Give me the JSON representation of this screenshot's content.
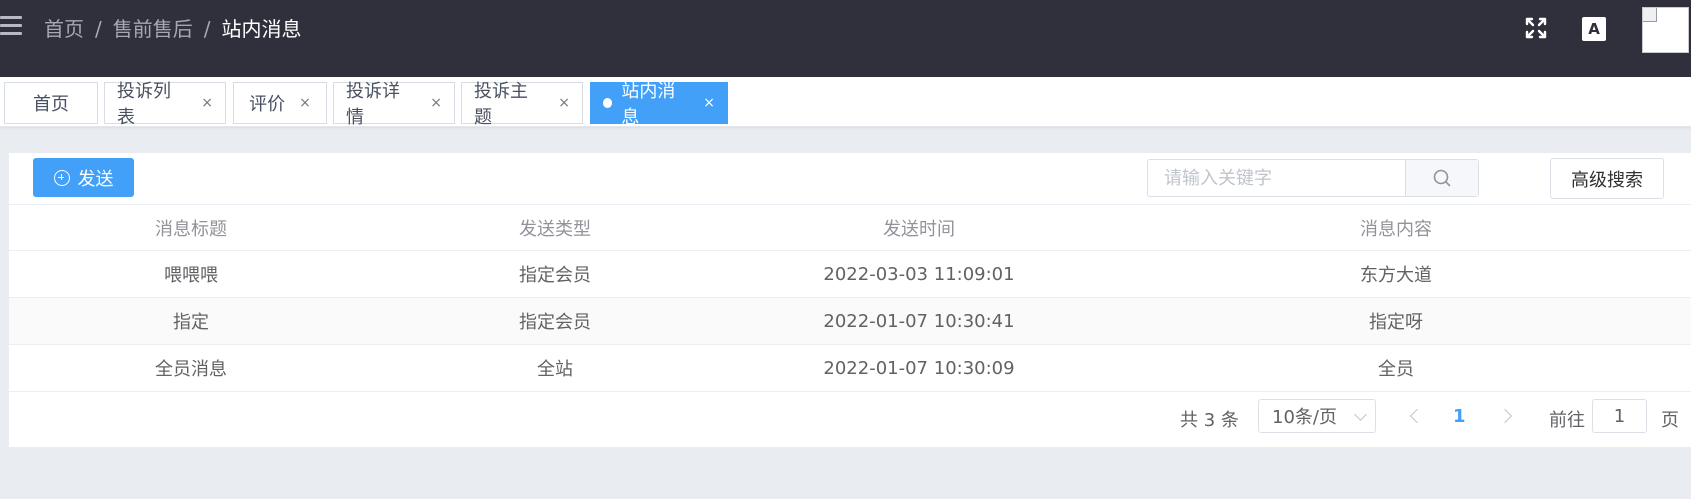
{
  "breadcrumb": [
    "首页",
    "售前售后",
    "站内消息"
  ],
  "breadcrumb_separator": "/",
  "tags": [
    {
      "label": "首页",
      "closable": false,
      "active": false
    },
    {
      "label": "投诉列表",
      "closable": true,
      "active": false
    },
    {
      "label": "评价",
      "closable": true,
      "active": false
    },
    {
      "label": "投诉详情",
      "closable": true,
      "active": false
    },
    {
      "label": "投诉主题",
      "closable": true,
      "active": false
    },
    {
      "label": "站内消息",
      "closable": true,
      "active": true
    }
  ],
  "tag_close_glyph": "×",
  "toolbar": {
    "send_label": "发送",
    "search_placeholder": "请输入关键字",
    "advanced_search_label": "高级搜索"
  },
  "table": {
    "columns": [
      "消息标题",
      "发送类型",
      "发送时间",
      "消息内容"
    ],
    "rows": [
      [
        "喂喂喂",
        "指定会员",
        "2022-03-03 11:09:01",
        "东方大道"
      ],
      [
        "指定",
        "指定会员",
        "2022-01-07 10:30:41",
        "指定呀"
      ],
      [
        "全员消息",
        "全站",
        "2022-01-07 10:30:09",
        "全员"
      ]
    ]
  },
  "pagination": {
    "total_text": "共 3 条",
    "page_size": "10条/页",
    "current_page": "1",
    "goto_label": "前往",
    "goto_value": "1",
    "page_unit": "页"
  },
  "icons": {
    "fullscreen": "fullscreen-icon",
    "translate": "translate-icon",
    "translate_glyph": "A",
    "search": "search-icon",
    "menu": "hamburger-icon"
  },
  "colors": {
    "topbar": "#30303d",
    "primary": "#42a0f8",
    "background": "#e9edf1"
  }
}
